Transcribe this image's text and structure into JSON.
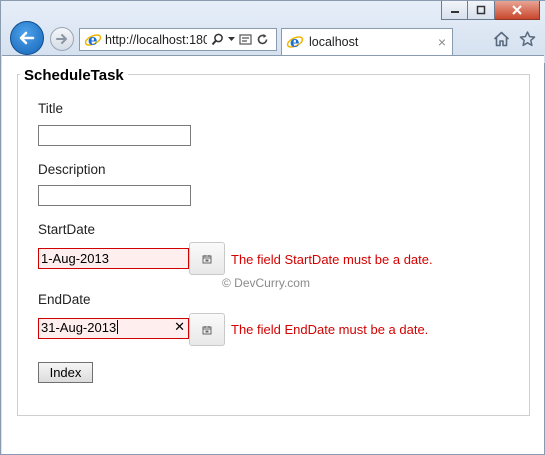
{
  "browser": {
    "address": "http://localhost:180",
    "tab_title": "localhost",
    "tab_close": "×"
  },
  "page": {
    "legend": "ScheduleTask",
    "watermark": "© DevCurry.com",
    "fields": {
      "title": {
        "label": "Title",
        "value": ""
      },
      "description": {
        "label": "Description",
        "value": ""
      },
      "start_date": {
        "label": "StartDate",
        "value": "1-Aug-2013",
        "error": "The field StartDate must be a date."
      },
      "end_date": {
        "label": "EndDate",
        "value": "31-Aug-2013",
        "clear": "✕",
        "error": "The field EndDate must be a date."
      }
    },
    "index_button": "Index"
  },
  "colors": {
    "error": "#d40000",
    "invalid_bg": "#ffeeee",
    "accent": "#1565b8"
  }
}
